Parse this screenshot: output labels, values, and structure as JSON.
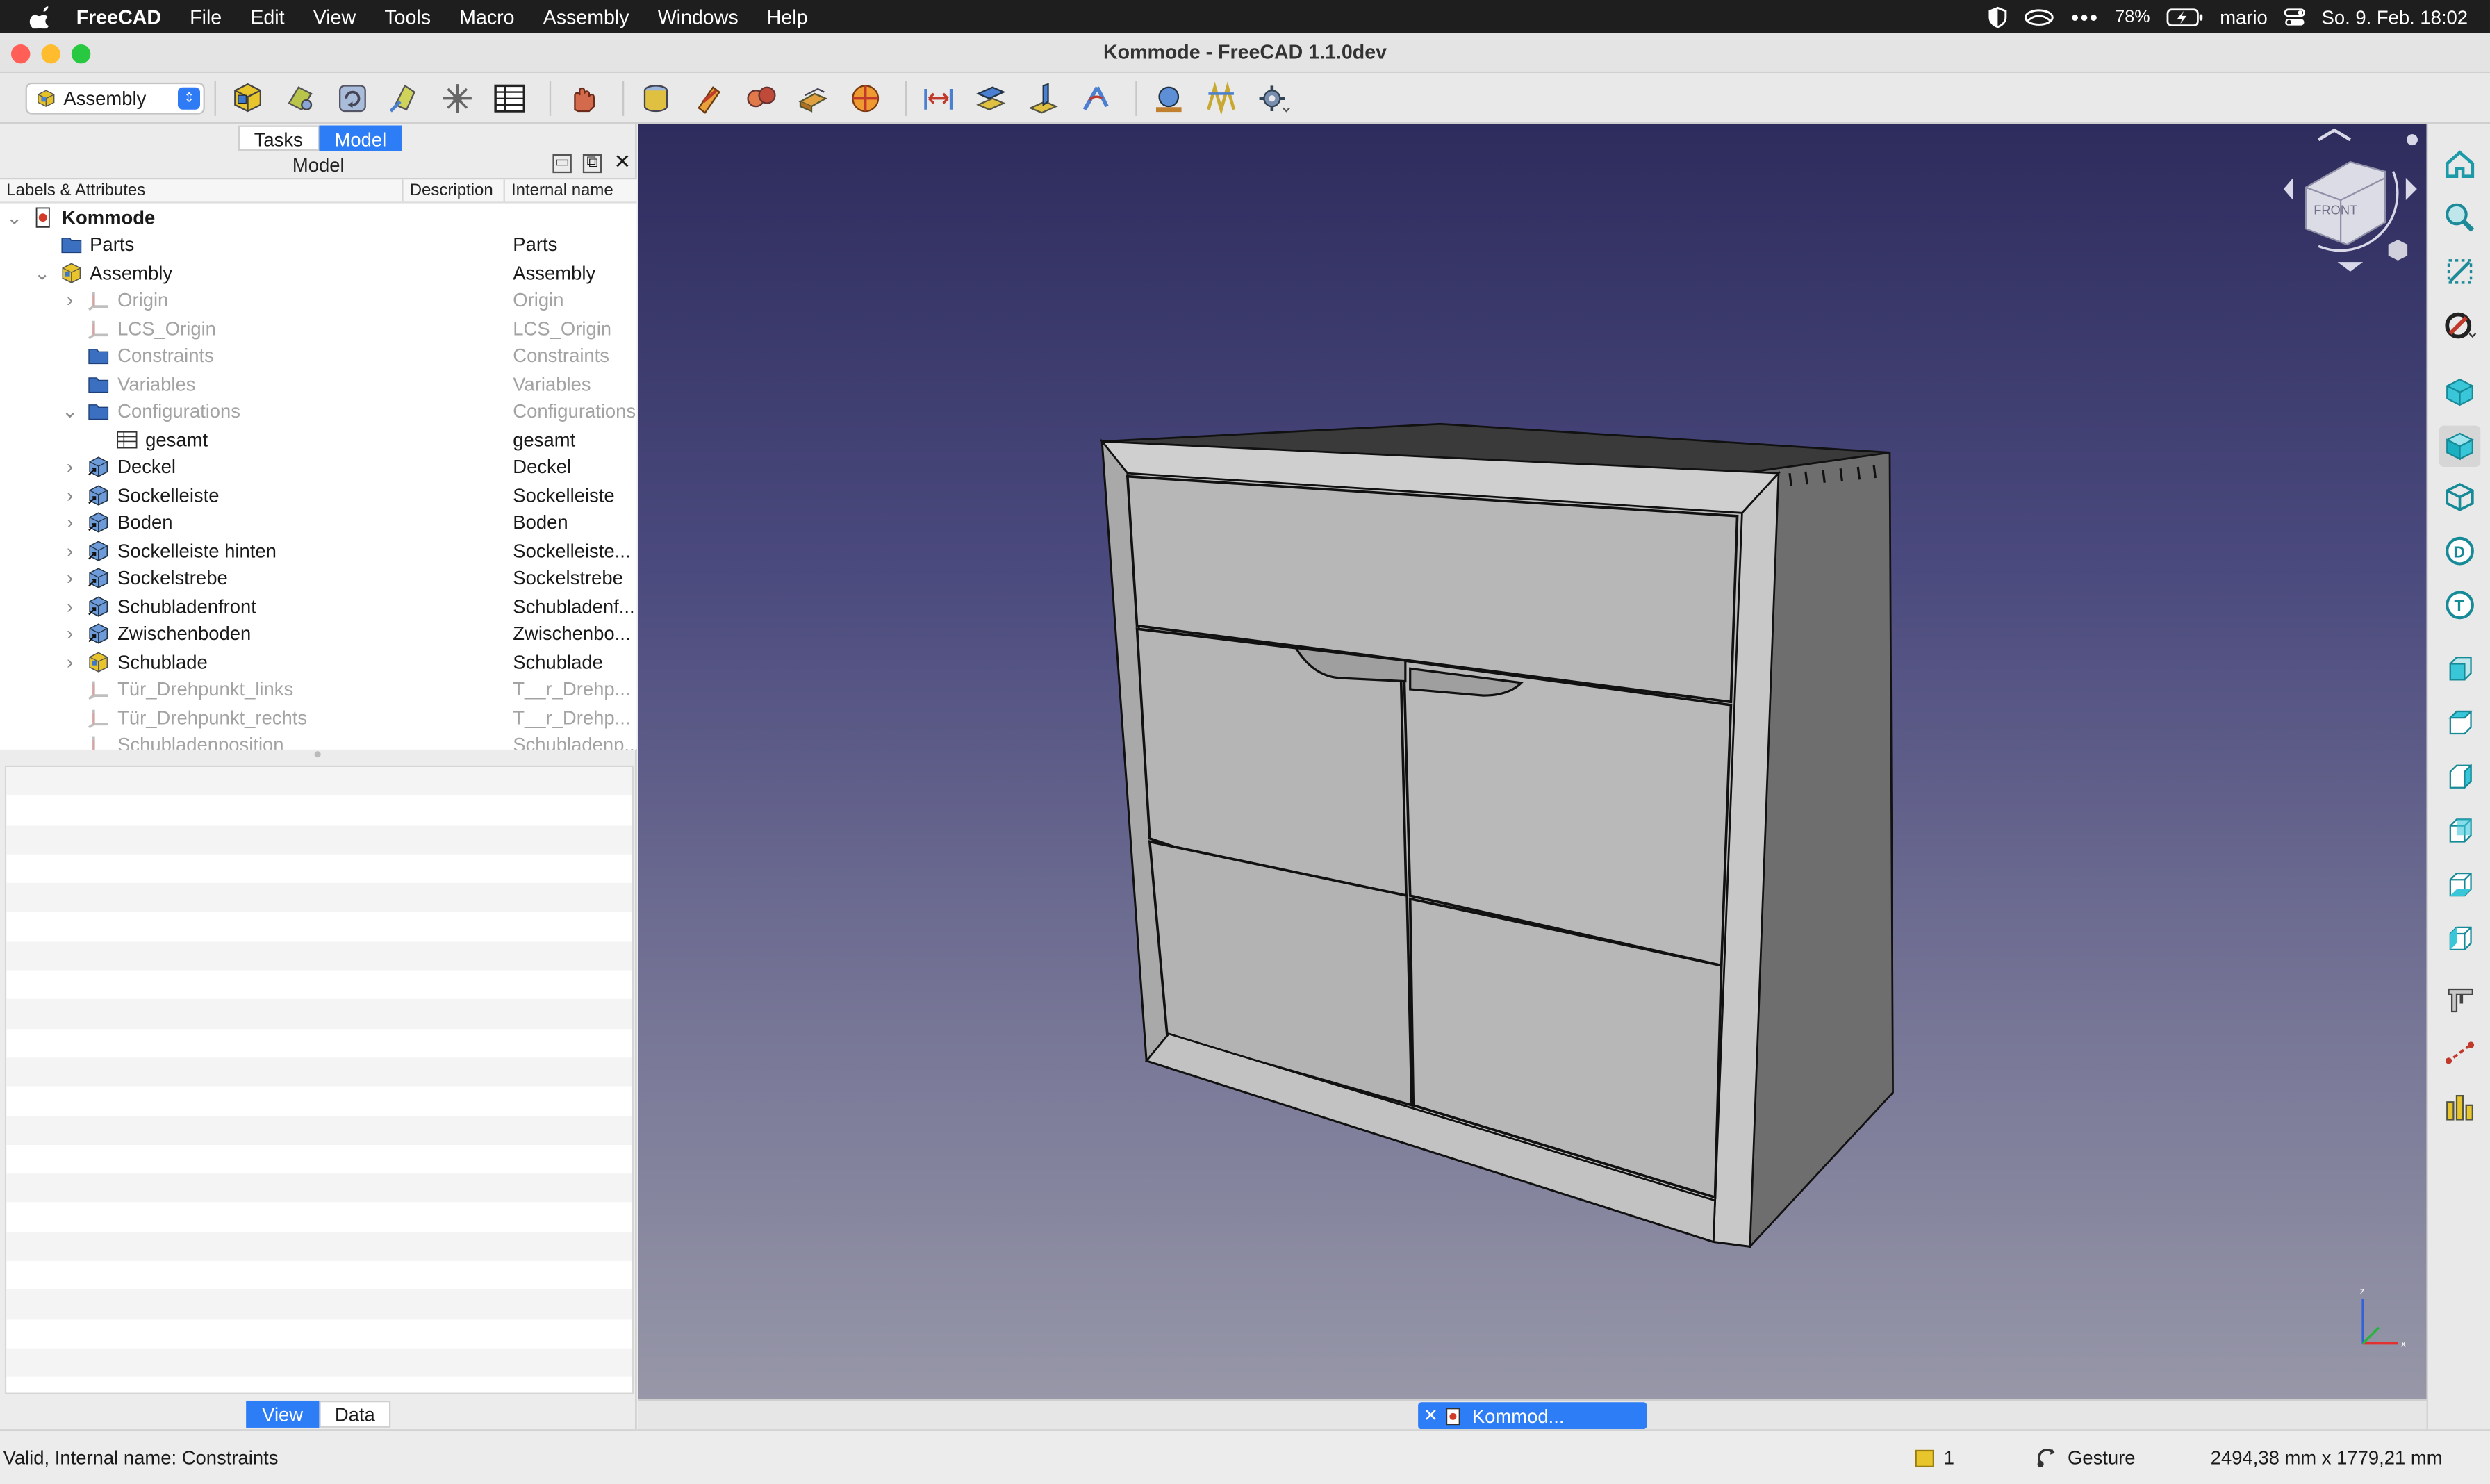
{
  "menubar": {
    "app_name": "FreeCAD",
    "items": [
      "File",
      "Edit",
      "View",
      "Tools",
      "Macro",
      "Assembly",
      "Windows",
      "Help"
    ],
    "battery": "78%",
    "user": "mario",
    "datetime": "So. 9. Feb.  18:02"
  },
  "window": {
    "title": "Kommode - FreeCAD 1.1.0dev"
  },
  "toolbar": {
    "workbench": "Assembly"
  },
  "left_panel": {
    "tabs": [
      "Tasks",
      "Model"
    ],
    "active_tab": "Model",
    "header": "Model",
    "columns": [
      "Labels & Attributes",
      "Description",
      "Internal name"
    ],
    "tree": [
      {
        "label": "Kommode",
        "internal": "",
        "level": 0,
        "chev": "v",
        "icon": "doc-icon",
        "bold": true,
        "dim": false
      },
      {
        "label": "Parts",
        "internal": "Parts",
        "level": 1,
        "chev": "",
        "icon": "folder-icon",
        "dim": false
      },
      {
        "label": "Assembly",
        "internal": "Assembly",
        "level": 1,
        "chev": "v",
        "icon": "assembly-icon",
        "dim": false
      },
      {
        "label": "Origin",
        "internal": "Origin",
        "level": 2,
        "chev": ">",
        "icon": "axes-icon",
        "dim": true
      },
      {
        "label": "LCS_Origin",
        "internal": "LCS_Origin",
        "level": 2,
        "chev": "",
        "icon": "axes-icon",
        "dim": true
      },
      {
        "label": "Constraints",
        "internal": "Constraints",
        "level": 2,
        "chev": "",
        "icon": "folder-icon",
        "dim": true
      },
      {
        "label": "Variables",
        "internal": "Variables",
        "level": 2,
        "chev": "",
        "icon": "folder-icon",
        "dim": true
      },
      {
        "label": "Configurations",
        "internal": "Configurations",
        "level": 2,
        "chev": "v",
        "icon": "folder-icon",
        "dim": true
      },
      {
        "label": "gesamt",
        "internal": "gesamt",
        "level": 3,
        "chev": "",
        "icon": "table-icon",
        "dim": false
      },
      {
        "label": "Deckel",
        "internal": "Deckel",
        "level": 2,
        "chev": ">",
        "icon": "part-link-icon",
        "dim": false
      },
      {
        "label": "Sockelleiste",
        "internal": "Sockelleiste",
        "level": 2,
        "chev": ">",
        "icon": "part-link-icon",
        "dim": false
      },
      {
        "label": "Boden",
        "internal": "Boden",
        "level": 2,
        "chev": ">",
        "icon": "part-link-icon",
        "dim": false
      },
      {
        "label": "Sockelleiste hinten",
        "internal": "Sockelleiste...",
        "level": 2,
        "chev": ">",
        "icon": "part-link-icon",
        "dim": false
      },
      {
        "label": "Sockelstrebe",
        "internal": "Sockelstrebe",
        "level": 2,
        "chev": ">",
        "icon": "part-link-icon",
        "dim": false
      },
      {
        "label": "Schubladenfront",
        "internal": "Schubladenf...",
        "level": 2,
        "chev": ">",
        "icon": "part-link-icon",
        "dim": false
      },
      {
        "label": "Zwischenboden",
        "internal": "Zwischenbo...",
        "level": 2,
        "chev": ">",
        "icon": "part-link-icon",
        "dim": false
      },
      {
        "label": "Schublade",
        "internal": "Schublade",
        "level": 2,
        "chev": ">",
        "icon": "assembly-icon",
        "dim": false
      },
      {
        "label": "Tür_Drehpunkt_links",
        "internal": "T__r_Drehp...",
        "level": 2,
        "chev": "",
        "icon": "axes-icon",
        "dim": true
      },
      {
        "label": "Tür_Drehpunkt_rechts",
        "internal": "T__r_Drehp...",
        "level": 2,
        "chev": "",
        "icon": "axes-icon",
        "dim": true
      },
      {
        "label": "Schubladenposition",
        "internal": "Schubladenp...",
        "level": 2,
        "chev": "",
        "icon": "axes-icon",
        "dim": true
      }
    ],
    "bottom_tabs": [
      "View",
      "Data"
    ],
    "bottom_active": "View"
  },
  "viewport": {
    "navcube_face": "FRONT",
    "doc_tab": "Kommod..."
  },
  "statusbar": {
    "message": "Valid, Internal name: Constraints",
    "selection_count": "1",
    "nav_style": "Gesture",
    "dimensions": "2494,38 mm x 1779,21 mm"
  },
  "colors": {
    "accent": "#2d7df6",
    "viewport_top": "#2e2c5d",
    "viewport_bottom": "#9797a8"
  }
}
